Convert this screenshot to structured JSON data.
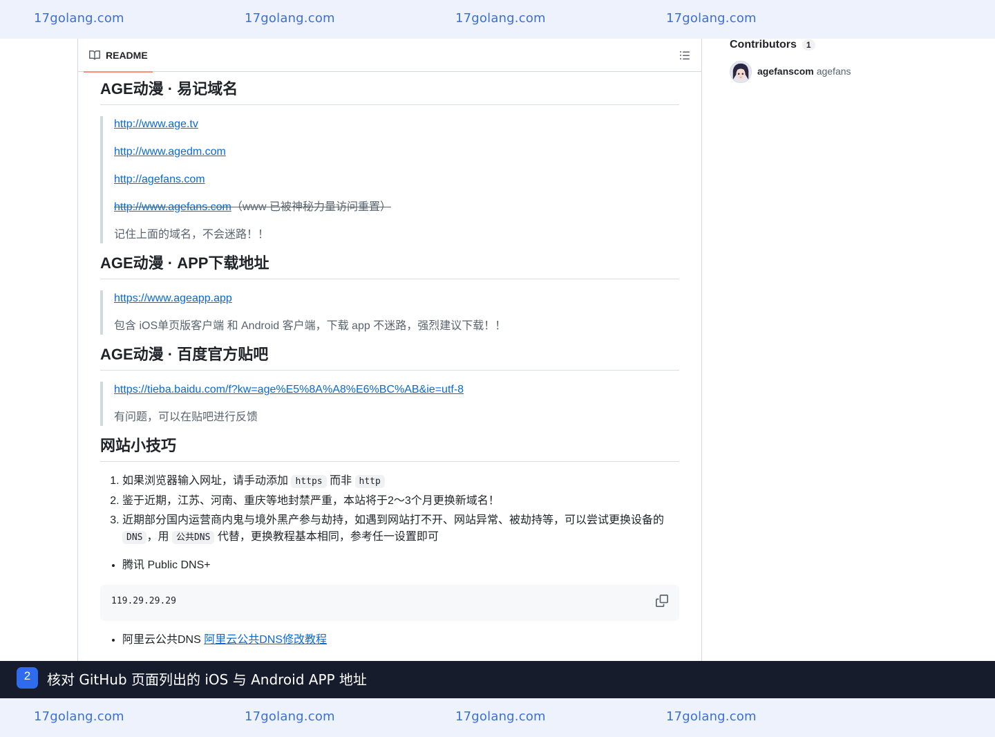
{
  "watermark": {
    "text": "17golang.com"
  },
  "readme": {
    "tab_label": "README",
    "sections": [
      {
        "heading": "AGE动漫 · 易记域名",
        "links": [
          "http://www.age.tv",
          "http://www.agedm.com",
          "http://agefans.com"
        ],
        "struck_link": "http://www.agefans.com",
        "struck_note": "（www 已被神秘力量访问重置）",
        "note": "记住上面的域名，不会迷路！！"
      },
      {
        "heading": "AGE动漫 · APP下载地址",
        "link": "https://www.ageapp.app",
        "note": "包含 iOS单页版客户端 和 Android 客户端，下载 app 不迷路，强烈建议下载！！"
      },
      {
        "heading": "AGE动漫 · 百度官方贴吧",
        "link": "https://tieba.baidu.com/f?kw=age%E5%8A%A8%E6%BC%AB&ie=utf-8",
        "note": "有问题，可以在贴吧进行反馈"
      },
      {
        "heading": "网站小技巧"
      }
    ],
    "tips": {
      "t1_pre": "如果浏览器输入网址，请手动添加",
      "t1_code1": "https",
      "t1_mid": "而非",
      "t1_code2": "http",
      "t2": "鉴于近期，江苏、河南、重庆等地封禁严重，本站将于2～3个月更换新域名！",
      "t3_pre": "近期部分国内运营商内鬼与境外黑产参与劫持，如遇到网站打不开、网站异常、被劫持等，可以尝试更换设备的",
      "t3_code1": "DNS",
      "t3_mid": "，用",
      "t3_code2": "公共DNS",
      "t3_post": "代替，更换教程基本相同，参考任一设置即可"
    },
    "dns": {
      "item1": "腾讯 Public DNS+",
      "code1": "119.29.29.29",
      "item2_pre": "阿里云公共DNS",
      "item2_link": "阿里云公共DNS修改教程"
    }
  },
  "sidebar": {
    "contributors_title": "Contributors",
    "contributors_count": "1",
    "contributor_login": "agefanscom",
    "contributor_name": "agefans"
  },
  "caption": {
    "step": "2",
    "text": "核对 GitHub 页面列出的 iOS 与 Android APP 地址"
  }
}
